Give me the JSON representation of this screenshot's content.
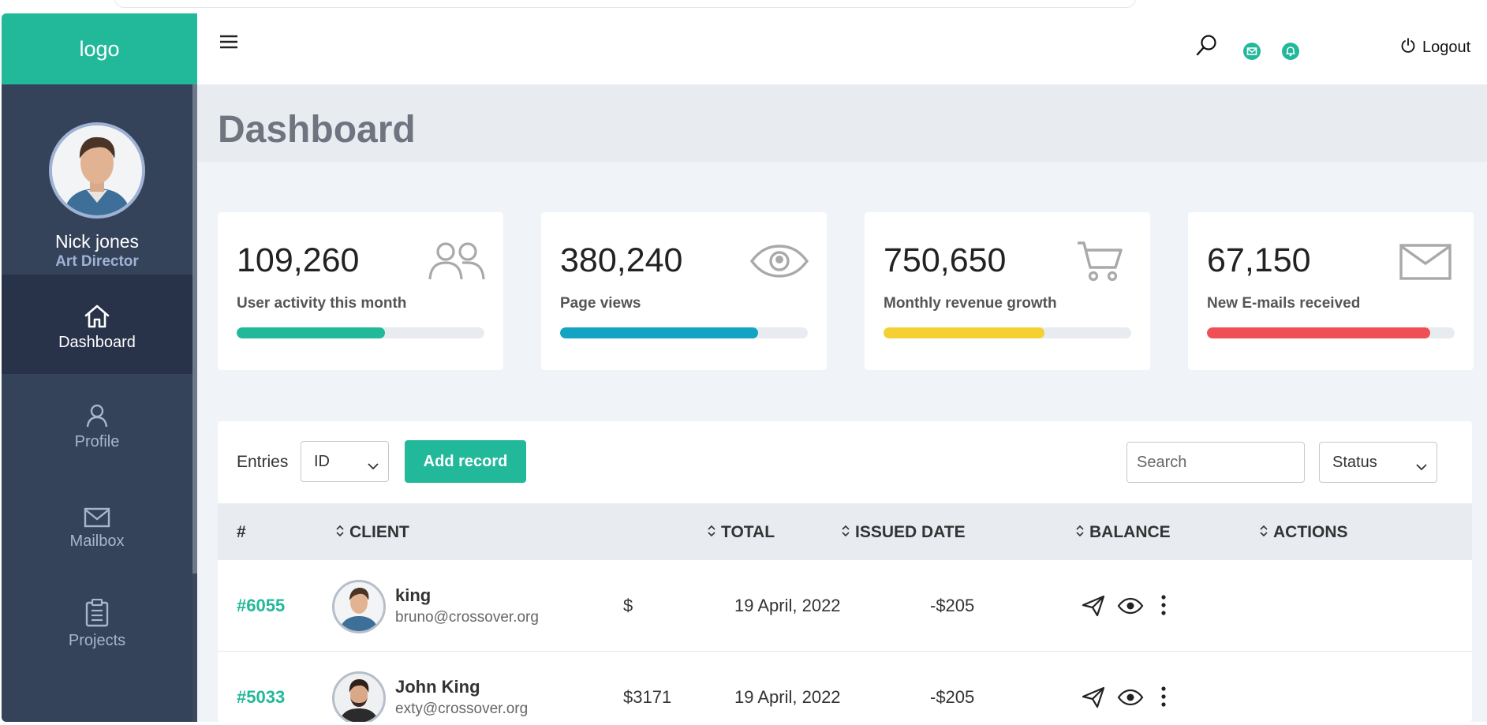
{
  "app": {
    "logo": "logo"
  },
  "user": {
    "name": "Nick jones",
    "role": "Art Director"
  },
  "nav": [
    {
      "label": "Dashboard",
      "icon": "home-icon",
      "active": true
    },
    {
      "label": "Profile",
      "icon": "user-icon",
      "active": false
    },
    {
      "label": "Mailbox",
      "icon": "envelope-icon",
      "active": false
    },
    {
      "label": "Projects",
      "icon": "clipboard-icon",
      "active": false
    }
  ],
  "topbar": {
    "logout_label": "Logout"
  },
  "page": {
    "title": "Dashboard"
  },
  "stats": [
    {
      "value": "109,260",
      "label": "User activity this month",
      "icon": "users-icon",
      "color": "#22b89a",
      "progress": 0.6
    },
    {
      "value": "380,240",
      "label": "Page views",
      "icon": "eye-icon",
      "color": "#12a4c2",
      "progress": 0.8
    },
    {
      "value": "750,650",
      "label": "Monthly revenue growth",
      "icon": "cart-icon",
      "color": "#f4d033",
      "progress": 0.65
    },
    {
      "value": "67,150",
      "label": "New E-mails received",
      "icon": "envelope-icon",
      "color": "#ef5055",
      "progress": 0.9
    }
  ],
  "table": {
    "entries_label": "Entries",
    "entries_select": "ID",
    "add_label": "Add record",
    "search_placeholder": "Search",
    "status_select": "Status",
    "columns": [
      "#",
      "CLIENT",
      "TOTAL",
      "ISSUED DATE",
      "BALANCE",
      "ACTIONS"
    ],
    "rows": [
      {
        "id": "#6055",
        "name": "king",
        "email": "bruno@crossover.org",
        "total": "$",
        "date": "19 April, 2022",
        "balance": "-$205"
      },
      {
        "id": "#5033",
        "name": "John King",
        "email": "exty@crossover.org",
        "total": "$3171",
        "date": "19 April, 2022",
        "balance": "-$205"
      }
    ]
  }
}
